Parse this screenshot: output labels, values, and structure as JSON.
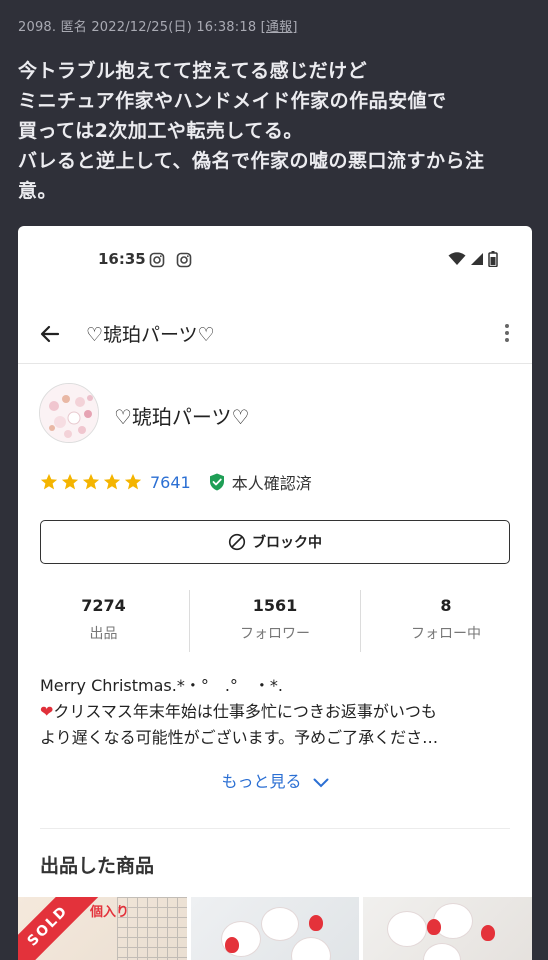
{
  "post": {
    "number": "2098.",
    "author": "匿名",
    "datetime": "2022/12/25(日) 16:38:18",
    "report_link": "[通報]",
    "lines": [
      "今トラブル抱えてて控えてる感じだけど",
      "ミニチュア作家やハンドメイド作家の作品安値で",
      "買っては2次加工や転売してる。",
      "バレると逆上して、偽名で作家の嘘の悪口流すから注",
      "意。"
    ]
  },
  "phone": {
    "status": {
      "time": "16:35"
    },
    "appbar": {
      "title": "♡琥珀パーツ♡"
    },
    "profile": {
      "name": "♡琥珀パーツ♡",
      "rating_count": "7641",
      "stars": 5,
      "verified_label": "本人確認済",
      "block_button": "ブロック中"
    },
    "stats": [
      {
        "value": "7274",
        "label": "出品"
      },
      {
        "value": "1561",
        "label": "フォロワー"
      },
      {
        "value": "8",
        "label": "フォロー中"
      }
    ],
    "bio": {
      "line1": "Merry Christmas.*・°　.°　・*.",
      "line2": "クリスマス年末年始は仕事多忙につきお返事がいつも",
      "line3": "より遅くなる可能性がございます。予めご了承くださ…",
      "heart": "❤"
    },
    "more_link": "もっと見る",
    "section_title": "出品した商品",
    "thumbs": {
      "sold_label": "SOLD",
      "tag1": "個入り"
    }
  },
  "colors": {
    "bg": "#2f3039",
    "accent_blue": "#2b6fd3",
    "star": "#f4b400",
    "verified": "#1e9e55",
    "sold": "#e3323b"
  }
}
